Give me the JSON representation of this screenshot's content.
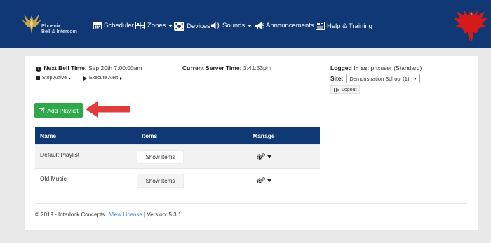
{
  "navbar": {
    "brand_line1": "Phoenix",
    "brand_line2": "Bell & Intercom",
    "items": [
      {
        "label": "Scheduler",
        "icon": "calendar-icon",
        "has_caret": false
      },
      {
        "label": "Zones",
        "icon": "zones-grid-icon",
        "has_caret": true
      },
      {
        "label": "Devices",
        "icon": "devices-icon",
        "has_caret": false
      },
      {
        "label": "Sounds",
        "icon": "speaker-icon",
        "has_caret": true
      },
      {
        "label": "Announcements",
        "icon": "megaphone-icon",
        "has_caret": false
      },
      {
        "label": "Help & Training",
        "icon": "help-book-icon",
        "has_caret": false
      }
    ],
    "colors": {
      "background": "#0f3875",
      "text": "#ffffff"
    }
  },
  "status": {
    "next_bell_label": "Next Bell Time:",
    "next_bell_value": "Sep 20th 7:00:00am",
    "stop_active_label": "Stop Active",
    "execute_alert_label": "Execute Alert",
    "server_time_label": "Current Server Time:",
    "server_time_value": "3:41:53pm"
  },
  "user": {
    "logged_in_label": "Logged in as:",
    "logged_in_value": "phxuser (Standard)",
    "site_label": "Site:",
    "site_value": "Demonstration School (1)",
    "logout_label": "Logout"
  },
  "actions": {
    "add_playlist_label": "Add Playlist",
    "add_playlist_color": "#2ea84a",
    "arrow_color": "#e03c3c"
  },
  "table": {
    "headers": [
      "Name",
      "Items",
      "Manage"
    ],
    "rows": [
      {
        "name": "Default Playlist",
        "items_button": "Show Items"
      },
      {
        "name": "Old Music",
        "items_button": "Show Items"
      }
    ]
  },
  "footer": {
    "copyright": "© 2019 - Interlock Concepts |",
    "license_link": "View License",
    "version": "| Version: 5.3.1",
    "link_color": "#3a7bd5"
  }
}
